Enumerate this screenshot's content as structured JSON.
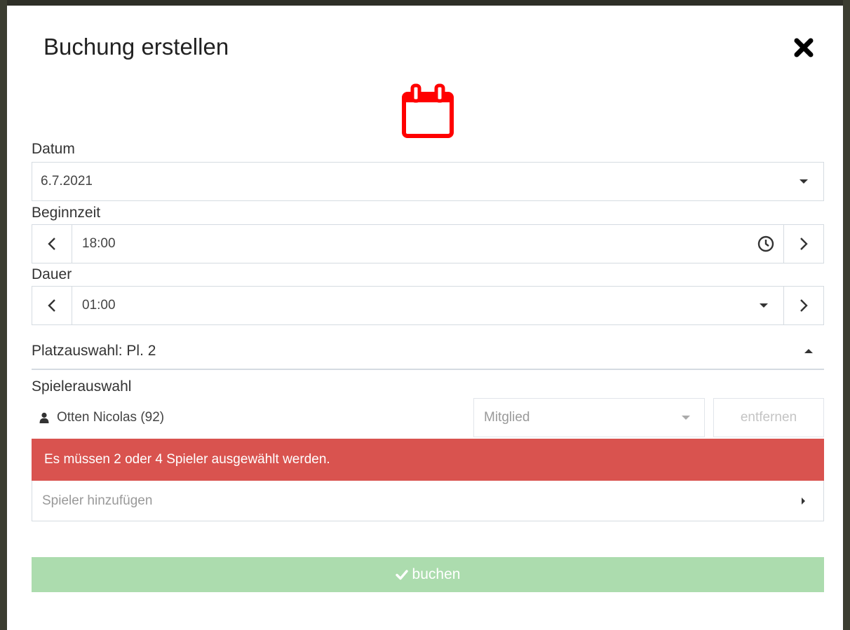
{
  "dialog": {
    "title": "Buchung erstellen",
    "close_icon": "close-icon",
    "header_icon": "calendar-icon",
    "accent_color": "#ff0000"
  },
  "date": {
    "label": "Datum",
    "value": "6.7.2021"
  },
  "start_time": {
    "label": "Beginnzeit",
    "value": "18:00"
  },
  "duration": {
    "label": "Dauer",
    "value": "01:00"
  },
  "court": {
    "label": "Platzauswahl: Pl. 2"
  },
  "players": {
    "label": "Spielerauswahl",
    "list": [
      {
        "name": "Otten Nicolas (92)",
        "role": "Mitglied",
        "remove_label": "entfernen"
      }
    ],
    "error": "Es müssen 2 oder 4 Spieler ausgewählt werden.",
    "error_color": "#d9534f",
    "add_placeholder": "Spieler hinzufügen"
  },
  "submit": {
    "label": "buchen",
    "color": "#acdcae"
  }
}
